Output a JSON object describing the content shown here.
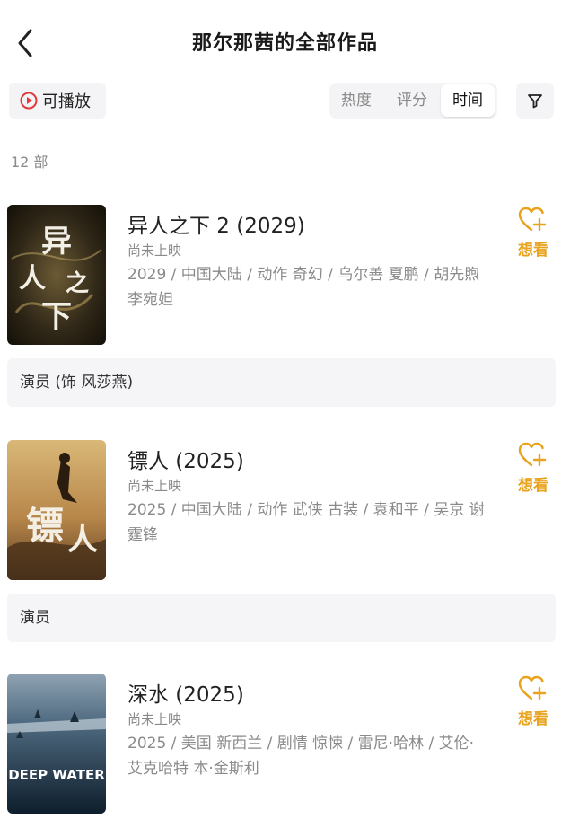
{
  "header": {
    "title": "那尔那茜的全部作品"
  },
  "toolbar": {
    "playable_label": "可播放",
    "sort_options": [
      "热度",
      "评分",
      "时间"
    ],
    "selected_sort": "时间"
  },
  "count_label": "12 部",
  "colors": {
    "accent": "#e8a21c",
    "play_red": "#e03b3b"
  },
  "movies": [
    {
      "title": "异人之下 2 (2029)",
      "status": "尚未上映",
      "info": "2029 / 中国大陆 / 动作 奇幻 / 乌尔善 夏鹏 / 胡先煦 李宛妲",
      "want_label": "想看",
      "role": "演员 (饰 风莎燕)",
      "poster_text": "异人之下"
    },
    {
      "title": "镖人 (2025)",
      "status": "尚未上映",
      "info": "2025 / 中国大陆 / 动作 武侠 古装 / 袁和平 / 吴京 谢霆锋",
      "want_label": "想看",
      "role": "演员",
      "poster_text": "镖人"
    },
    {
      "title": "深水 (2025)",
      "status": "尚未上映",
      "info": "2025 / 美国 新西兰 / 剧情 惊悚 / 雷尼·哈林 / 艾伦·艾克哈特 本·金斯利",
      "want_label": "想看",
      "poster_text": "DEEP WATER"
    }
  ]
}
